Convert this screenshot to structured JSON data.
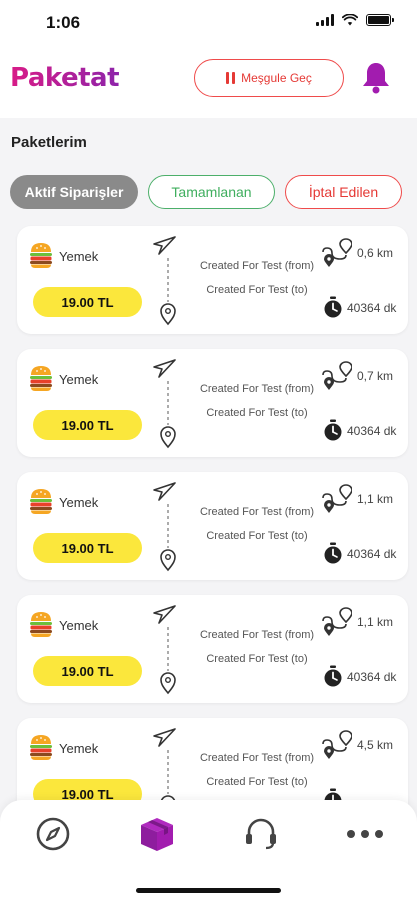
{
  "status_bar": {
    "time": "1:06"
  },
  "header": {
    "logo": "Paketat",
    "busy_button_label": "Meşgule Geç"
  },
  "section_title": "Paketlerim",
  "tabs": [
    {
      "label": "Aktif Siparişler",
      "active": true
    },
    {
      "label": "Tamamlanan",
      "active": false
    },
    {
      "label": "İptal Edilen",
      "active": false
    }
  ],
  "orders": [
    {
      "category": "Yemek",
      "price": "19.00 TL",
      "from": "Created For Test (from)",
      "to": "Created For Test (to)",
      "distance": "0,6 km",
      "duration": "40364 dk"
    },
    {
      "category": "Yemek",
      "price": "19.00 TL",
      "from": "Created For Test (from)",
      "to": "Created For Test (to)",
      "distance": "0,7 km",
      "duration": "40364 dk"
    },
    {
      "category": "Yemek",
      "price": "19.00 TL",
      "from": "Created For Test (from)",
      "to": "Created For Test (to)",
      "distance": "1,1 km",
      "duration": "40364 dk"
    },
    {
      "category": "Yemek",
      "price": "19.00 TL",
      "from": "Created For Test (from)",
      "to": "Created For Test (to)",
      "distance": "1,1 km",
      "duration": "40364 dk"
    },
    {
      "category": "Yemek",
      "price": "19.00 TL",
      "from": "Created For Test (from)",
      "to": "Created For Test (to)",
      "distance": "4,5 km",
      "duration": ""
    }
  ],
  "bottom_nav": [
    {
      "icon": "compass-icon",
      "active": false
    },
    {
      "icon": "package-icon",
      "active": true
    },
    {
      "icon": "headset-icon",
      "active": false
    },
    {
      "icon": "more-icon",
      "active": false
    }
  ],
  "colors": {
    "brand": "#a21caf",
    "price_badge": "#fbe73c",
    "busy_red": "#e53935",
    "completed_green": "#3fae5e",
    "active_tab_gray": "#8a8a8a"
  }
}
